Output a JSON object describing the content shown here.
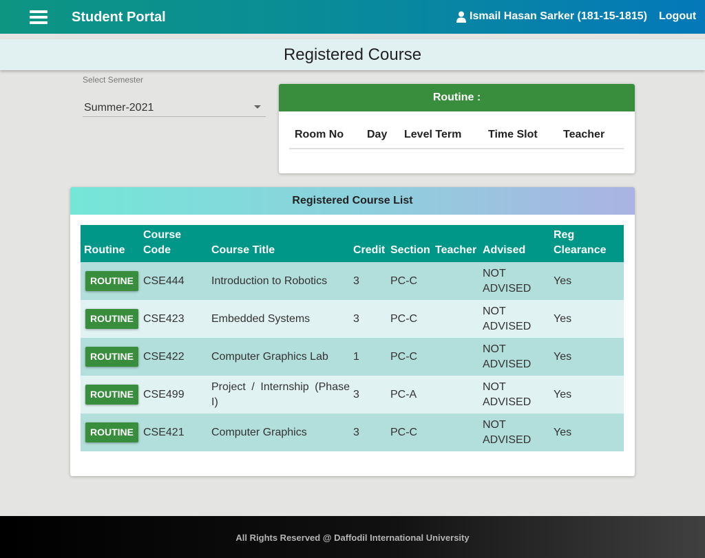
{
  "header": {
    "brand": "Student Portal",
    "user": "Ismail Hasan Sarker (181-15-1815)",
    "logout": "Logout"
  },
  "page_title": "Registered Course",
  "semester": {
    "label": "Select Semester",
    "value": "Summer-2021"
  },
  "routine": {
    "title": "Routine :",
    "columns": [
      "Room No",
      "Day",
      "Level Term",
      "Time Slot",
      "Teacher"
    ]
  },
  "course_list": {
    "title": "Registered Course List",
    "columns": {
      "routine": "Routine",
      "course_code_1": "Course",
      "course_code_2": "Code",
      "course_title": "Course Title",
      "credit": "Credit",
      "section": "Section",
      "teacher": "Teacher",
      "advised": "Advised",
      "reg_clearance_1": "Reg",
      "reg_clearance_2": "Clearance"
    },
    "rows": [
      {
        "button": "ROUTINE",
        "code": "CSE444",
        "title": "Introduction to Robotics",
        "credit": "3",
        "section": "PC-C",
        "teacher": "",
        "advised_1": "NOT",
        "advised_2": "ADVISED",
        "clearance": "Yes"
      },
      {
        "button": "ROUTINE",
        "code": "CSE423",
        "title": "Embedded Systems",
        "credit": "3",
        "section": "PC-C",
        "teacher": "",
        "advised_1": "NOT",
        "advised_2": "ADVISED",
        "clearance": "Yes"
      },
      {
        "button": "ROUTINE",
        "code": "CSE422",
        "title": "Computer Graphics Lab",
        "credit": "1",
        "section": "PC-C",
        "teacher": "",
        "advised_1": "NOT",
        "advised_2": "ADVISED",
        "clearance": "Yes"
      },
      {
        "button": "ROUTINE",
        "code": "CSE499",
        "title": "Project / Internship (Phase I)",
        "credit": "3",
        "section": "PC-A",
        "teacher": "",
        "advised_1": "NOT",
        "advised_2": "ADVISED",
        "clearance": "Yes"
      },
      {
        "button": "ROUTINE",
        "code": "CSE421",
        "title": "Computer Graphics",
        "credit": "3",
        "section": "PC-C",
        "teacher": "",
        "advised_1": "NOT",
        "advised_2": "ADVISED",
        "clearance": "Yes"
      }
    ]
  },
  "footer": "All Rights Reserved @ Daffodil International University"
}
